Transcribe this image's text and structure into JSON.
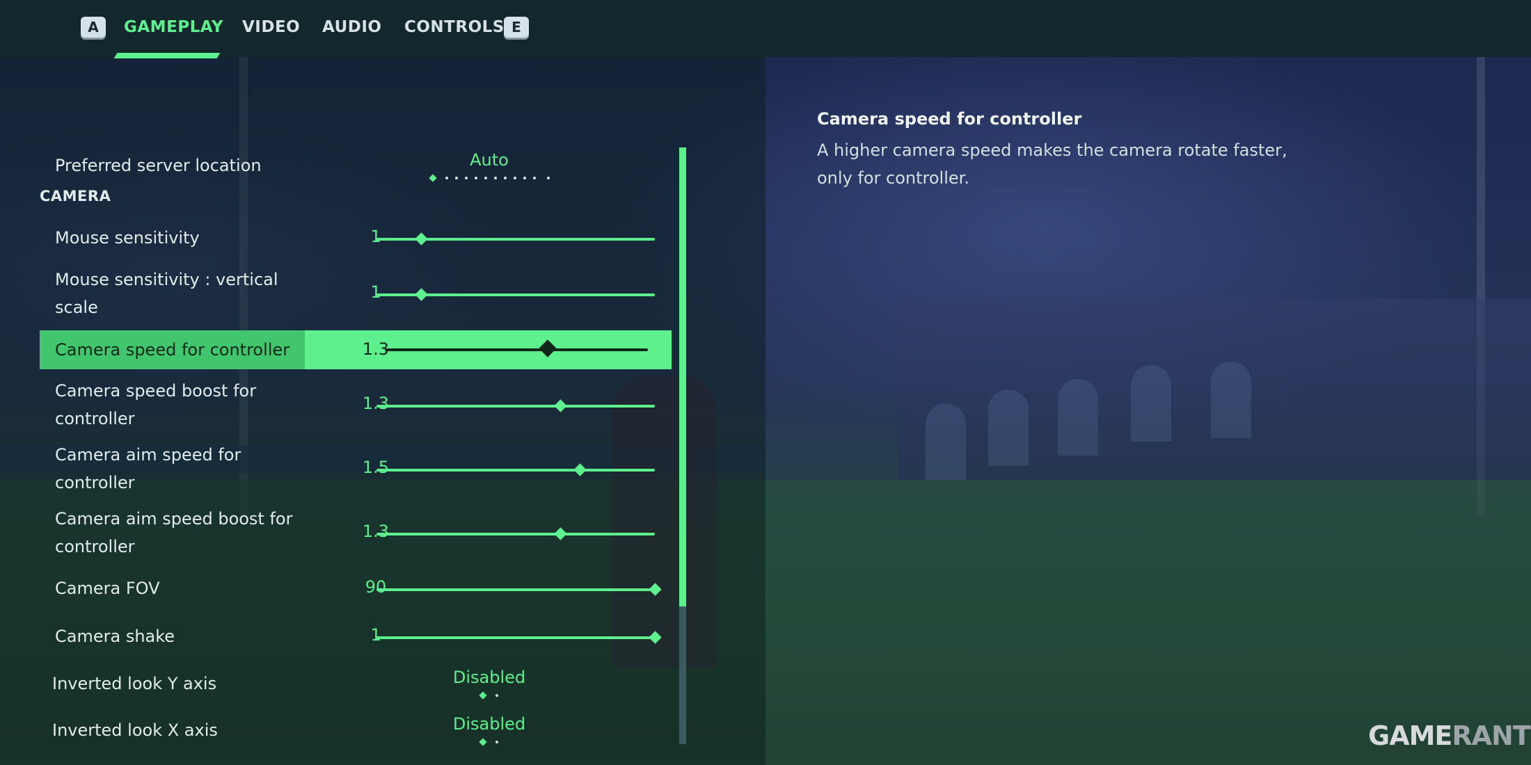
{
  "tabs": {
    "prev_key": "A",
    "next_key": "E",
    "items": [
      {
        "label": "GAMEPLAY",
        "active": true
      },
      {
        "label": "VIDEO",
        "active": false
      },
      {
        "label": "AUDIO",
        "active": false
      },
      {
        "label": "CONTROLS",
        "active": false
      }
    ]
  },
  "settings": {
    "server": {
      "label": "Preferred server location",
      "value": "Auto"
    },
    "section_camera": "CAMERA",
    "mouse_sensitivity": {
      "label": "Mouse sensitivity",
      "value": "1"
    },
    "mouse_vertical": {
      "label_line1": "Mouse sensitivity : vertical",
      "label_line2": "scale",
      "value": "1"
    },
    "camera_speed": {
      "label": "Camera speed for controller",
      "value": "1.3"
    },
    "camera_speed_boost": {
      "label_line1": "Camera speed boost for",
      "label_line2": "controller",
      "value": "1.3"
    },
    "camera_aim_speed": {
      "label_line1": "Camera aim speed for",
      "label_line2": "controller",
      "value": "1.5"
    },
    "camera_aim_boost": {
      "label_line1": "Camera aim speed boost for",
      "label_line2": "controller",
      "value": "1.3"
    },
    "camera_fov": {
      "label": "Camera FOV",
      "value": "90"
    },
    "camera_shake": {
      "label": "Camera shake",
      "value": "1"
    },
    "inverted_y": {
      "label": "Inverted look Y axis",
      "value": "Disabled"
    },
    "inverted_x": {
      "label": "Inverted look X axis",
      "value": "Disabled"
    }
  },
  "slider_levels": {
    "mouse_sensitivity": 0.16,
    "mouse_vertical": 0.16,
    "camera_speed": 0.62,
    "camera_speed_boost": 0.66,
    "camera_aim_speed": 0.73,
    "camera_aim_boost": 0.66,
    "camera_fov": 1.0,
    "camera_shake": 1.0
  },
  "description": {
    "title": "Camera speed for controller",
    "body": "A higher camera speed makes the camera rotate faster, only for controller."
  },
  "watermark": {
    "part1": "GAME",
    "part2": "RANT"
  },
  "colors": {
    "accent": "#5ef08e",
    "highlight": "#41c56d",
    "topbar": "#12282c"
  }
}
